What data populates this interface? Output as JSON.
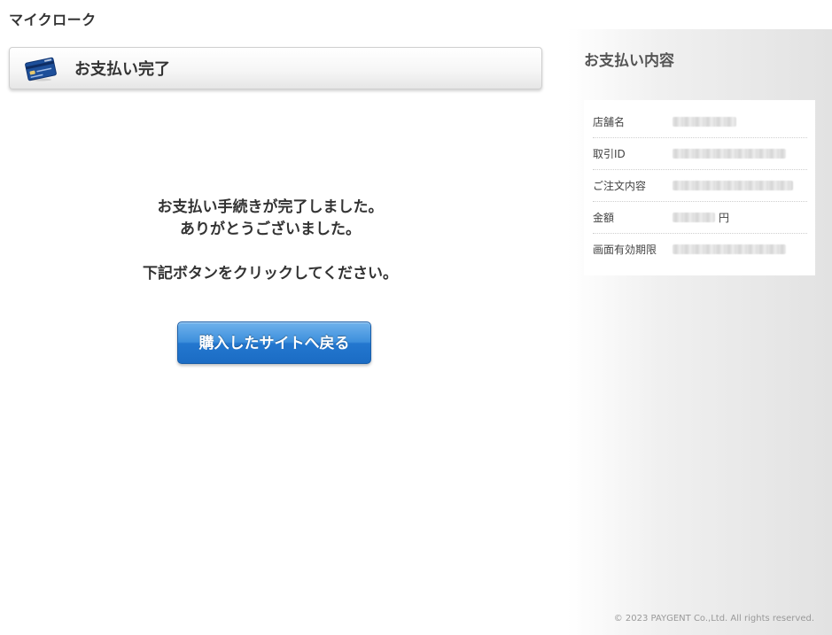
{
  "header": {
    "shop_name": "マイクローク"
  },
  "main": {
    "page_title": "お支払い完了",
    "message_lines": [
      "お支払い手続きが完了しました。",
      "ありがとうございました。",
      "下記ボタンをクリックしてください。"
    ],
    "return_button_label": "購入したサイトへ戻る"
  },
  "sidebar": {
    "title": "お支払い内容",
    "details": [
      {
        "label": "店舗名",
        "value": ""
      },
      {
        "label": "取引ID",
        "value": ""
      },
      {
        "label": "ご注文内容",
        "value": ""
      },
      {
        "label": "金額",
        "value": "",
        "unit": "円"
      },
      {
        "label": "画面有効期限",
        "value": ""
      }
    ]
  },
  "footer": {
    "copyright": "© 2023 PAYGENT Co.,Ltd. All rights reserved."
  },
  "colors": {
    "button_blue": "#2377cf",
    "sidebar_gray": "#e2e2e2"
  },
  "icons": {
    "title_icon": "credit-card-icon"
  }
}
